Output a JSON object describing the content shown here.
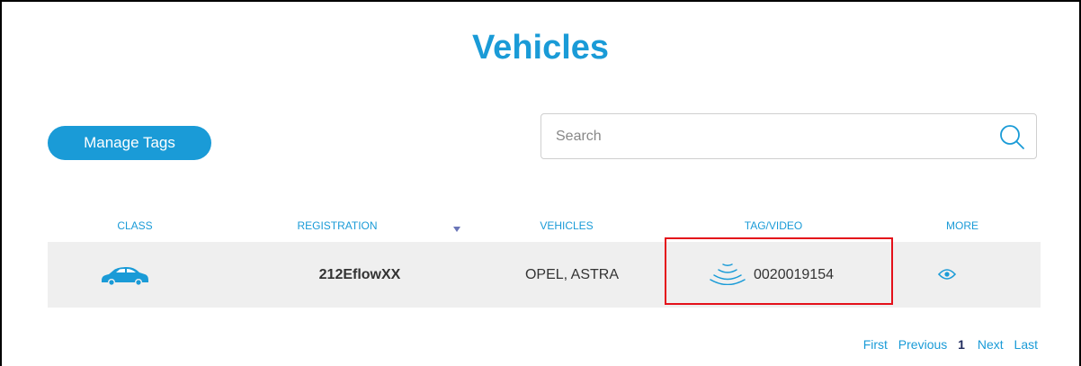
{
  "page": {
    "title": "Vehicles"
  },
  "toolbar": {
    "manage_tags_label": "Manage Tags"
  },
  "search": {
    "placeholder": "Search",
    "value": ""
  },
  "table": {
    "columns": {
      "class": "CLASS",
      "registration": "REGISTRATION",
      "vehicles": "VEHICLES",
      "tag_video": "TAG/VIDEO",
      "more": "MORE"
    },
    "rows": [
      {
        "class_icon": "car-icon",
        "registration": "212EflowXX",
        "vehicle": "OPEL, ASTRA",
        "tag_icon": "rfid-tag-icon",
        "tag": "0020019154",
        "more_icon": "eye-icon"
      }
    ]
  },
  "pagination": {
    "first": "First",
    "previous": "Previous",
    "current": "1",
    "next": "Next",
    "last": "Last"
  },
  "colors": {
    "accent": "#1a9bd7",
    "row_background": "#efefef",
    "highlight_box": "#e4101a"
  }
}
